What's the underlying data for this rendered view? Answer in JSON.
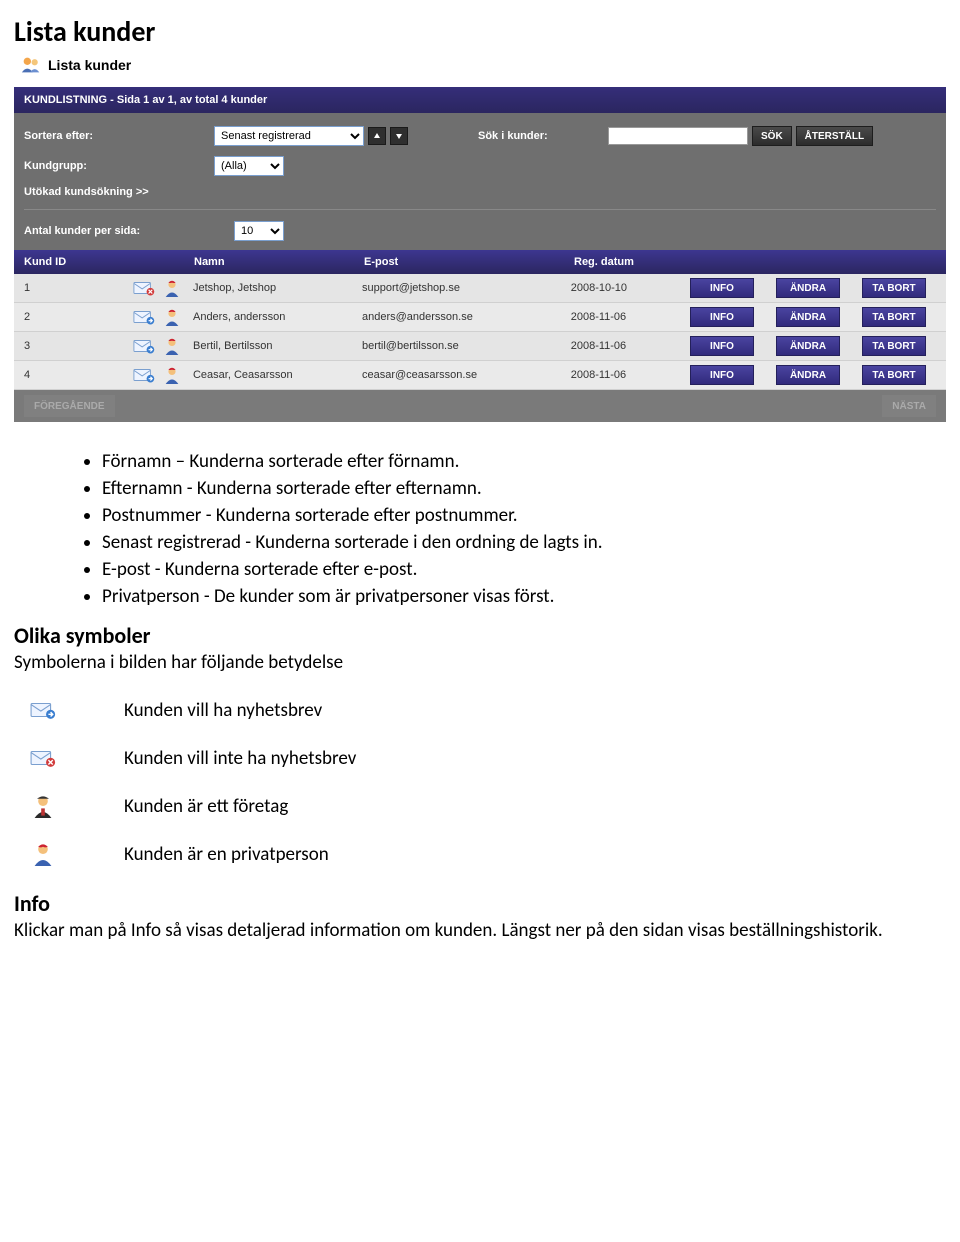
{
  "page_heading": "Lista kunder",
  "panel_title": "Lista kunder",
  "listing_header": "KUNDLISTNING - Sida 1 av 1, av total 4 kunder",
  "filters": {
    "sort_label": "Sortera efter:",
    "sort_value": "Senast registrerad",
    "search_label": "Sök i kunder:",
    "search_btn": "SÖK",
    "reset_btn": "ÅTERSTÄLL",
    "group_label": "Kundgrupp:",
    "group_value": "(Alla)",
    "extended_link": "Utökad kundsökning >>",
    "per_page_label": "Antal kunder per sida:",
    "per_page_value": "10"
  },
  "columns": {
    "id": "Kund ID",
    "name": "Namn",
    "email": "E-post",
    "date": "Reg. datum"
  },
  "row_buttons": {
    "info": "INFO",
    "edit": "ÄNDRA",
    "delete": "TA BORT"
  },
  "rows": [
    {
      "id": "1",
      "mail_ok": false,
      "person": true,
      "name": "Jetshop, Jetshop",
      "email": "support@jetshop.se",
      "date": "2008-10-10"
    },
    {
      "id": "2",
      "mail_ok": true,
      "person": true,
      "name": "Anders, andersson",
      "email": "anders@andersson.se",
      "date": "2008-11-06"
    },
    {
      "id": "3",
      "mail_ok": true,
      "person": true,
      "name": "Bertil, Bertilsson",
      "email": "bertil@bertilsson.se",
      "date": "2008-11-06"
    },
    {
      "id": "4",
      "mail_ok": true,
      "person": true,
      "name": "Ceasar, Ceasarsson",
      "email": "ceasar@ceasarsson.se",
      "date": "2008-11-06"
    }
  ],
  "pager": {
    "prev": "FÖREGÅENDE",
    "next": "NÄSTA"
  },
  "bullets": [
    "Förnamn – Kunderna sorterade efter förnamn.",
    "Efternamn - Kunderna sorterade efter efternamn.",
    "Postnummer - Kunderna sorterade efter postnummer.",
    "Senast registrerad - Kunderna sorterade i den ordning de lagts in.",
    "E-post - Kunderna sorterade efter e-post.",
    "Privatperson - De kunder som är privatpersoner visas först."
  ],
  "symbols_heading": "Olika symboler",
  "symbols_intro": "Symbolerna i bilden har följande betydelse",
  "legend": [
    "Kunden vill ha nyhetsbrev",
    "Kunden vill inte ha nyhetsbrev",
    "Kunden är ett företag",
    "Kunden är en privatperson"
  ],
  "info_heading": "Info",
  "info_text": "Klickar man på Info så visas detaljerad information om kunden. Längst ner på den sidan visas beställningshistorik."
}
